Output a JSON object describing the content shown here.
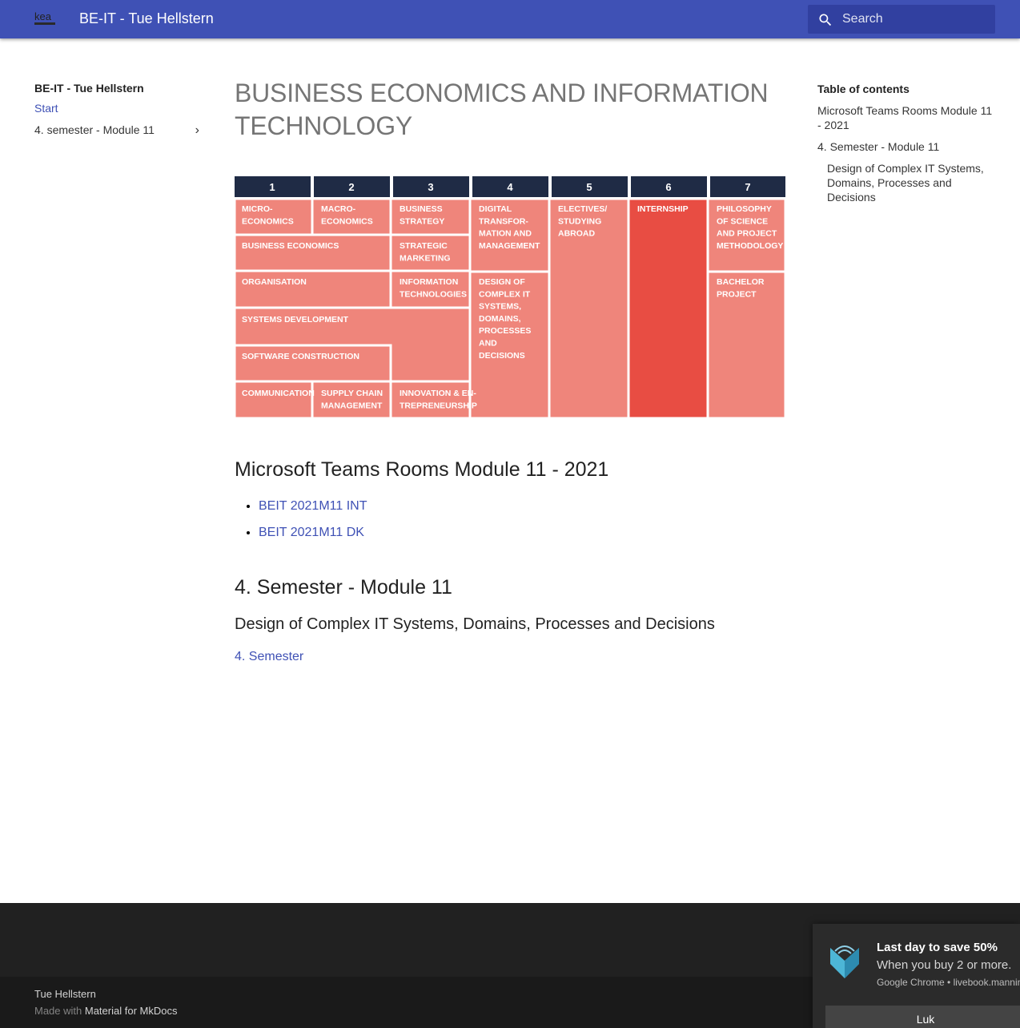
{
  "header": {
    "logo_text": "kea",
    "title": "BE-IT - Tue Hellstern",
    "search_placeholder": "Search"
  },
  "nav": {
    "title": "BE-IT - Tue Hellstern",
    "items": [
      {
        "label": "Start"
      },
      {
        "label": "4. semester - Module 11"
      }
    ]
  },
  "main": {
    "title": "BUSINESS ECONOMICS AND INFORMATION TECHNOLOGY",
    "curriculum": {
      "semesters": [
        "1",
        "2",
        "3",
        "4",
        "5",
        "6",
        "7"
      ],
      "blocks": [
        "MICRO-\nECONOMICS",
        "MACRO-\nECONOMICS",
        "BUSINESS\nSTRATEGY",
        "DIGITAL\nTRANSFOR-\nMATION AND\nMANAGEMENT",
        "ELECTIVES/\nSTUDYING\nABROAD",
        "INTERNSHIP",
        "PHILOSOPHY\nOF SCIENCE\nAND PROJECT\nMETHODOLOGY",
        "BUSINESS ECONOMICS",
        "STRATEGIC\nMARKETING",
        "ORGANISATION",
        "INFORMATION\nTECHNOLOGIES",
        "DESIGN OF\nCOMPLEX IT\nSYSTEMS,\nDOMAINS,\nPROCESSES\nAND\nDECISIONS",
        "BACHELOR\nPROJECT",
        "SYSTEMS DEVELOPMENT",
        "SOFTWARE CONSTRUCTION",
        "COMMUNICATION",
        "SUPPLY CHAIN\nMANAGEMENT",
        "INNOVATION & EN-\nTREPRENEURSHIP"
      ],
      "colors": {
        "header": "#1f2b45",
        "block": "#ef857b",
        "highlight": "#e84d43"
      }
    },
    "teams_heading": "Microsoft Teams Rooms Module 11 - 2021",
    "teams_links": [
      "BEIT 2021M11 INT",
      "BEIT 2021M11 DK"
    ],
    "semester_heading": "4. Semester - Module 11",
    "course_heading": "Design of Complex IT Systems, Domains, Processes and Decisions",
    "semester_link": "4. Semester"
  },
  "toc": {
    "title": "Table of contents",
    "items": [
      "Microsoft Teams Rooms Module 11 - 2021",
      "4. Semester - Module 11",
      "Design of Complex IT Systems, Domains, Processes and Decisions"
    ]
  },
  "footer": {
    "author": "Tue Hellstern",
    "made_with": "Made with",
    "made_with_link": "Material for MkDocs"
  },
  "notification": {
    "title": "Last day to save 50%",
    "body": "When you buy 2 or more.",
    "source": "Google Chrome • livebook.manning.com",
    "button": "Luk"
  }
}
